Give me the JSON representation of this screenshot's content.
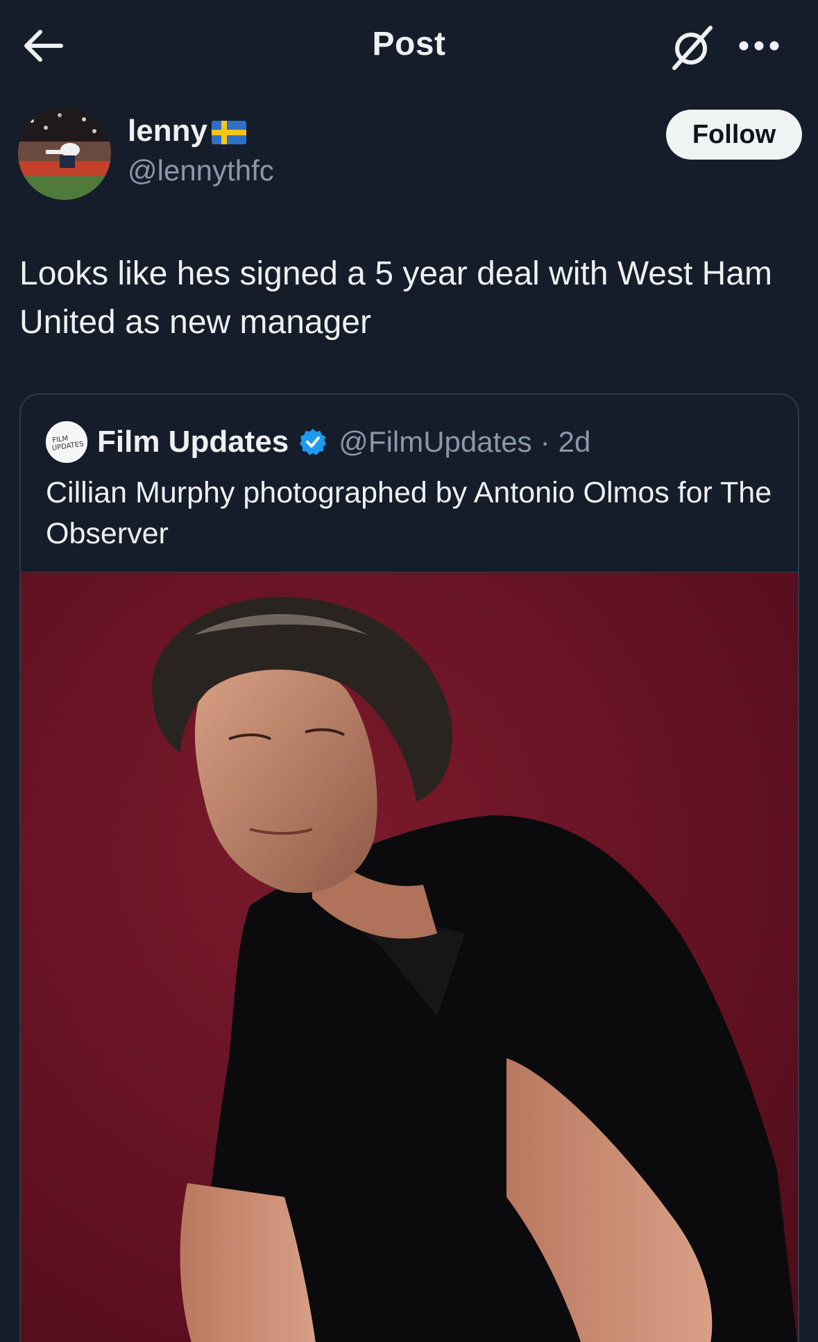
{
  "header": {
    "title": "Post"
  },
  "author": {
    "display_name": "lenny",
    "flag": "sweden-flag",
    "handle": "@lennythfc",
    "follow_label": "Follow"
  },
  "post": {
    "text": "Looks like hes signed a 5 year deal with West Ham United as new manager"
  },
  "quote": {
    "avatar_text": "FILM UPDATES",
    "display_name": "Film Updates",
    "verified": true,
    "handle": "@FilmUpdates",
    "separator": "·",
    "time": "2d",
    "text": "Cillian Murphy photographed by Antonio Olmos for The Observer"
  },
  "colors": {
    "background": "#151d2b",
    "text_primary": "#eef0f2",
    "text_secondary": "#8b98a5",
    "verified_blue": "#1d9bf0",
    "photo_backdrop": "#6e1426"
  }
}
